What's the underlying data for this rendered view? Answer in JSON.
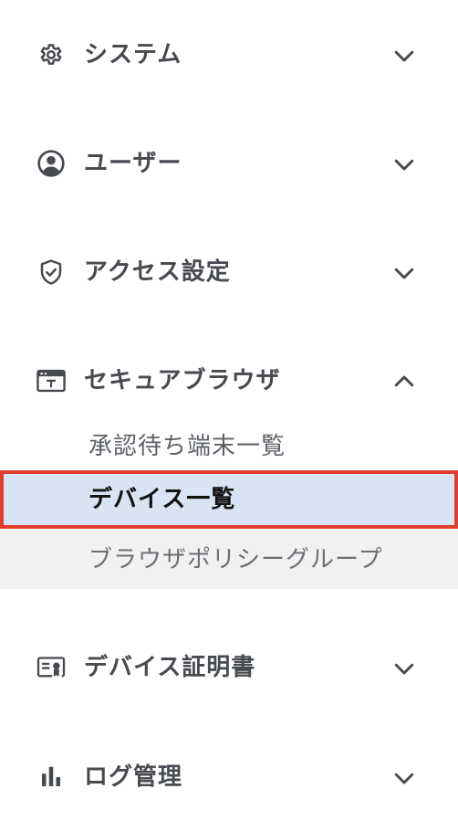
{
  "sections": [
    {
      "label": "システム",
      "icon": "gear-icon",
      "expanded": false
    },
    {
      "label": "ユーザー",
      "icon": "user-icon",
      "expanded": false
    },
    {
      "label": "アクセス設定",
      "icon": "shield-check-icon",
      "expanded": false
    },
    {
      "label": "セキュアブラウザ",
      "icon": "browser-window-icon",
      "expanded": true
    },
    {
      "label": "デバイス証明書",
      "icon": "certificate-icon",
      "expanded": false
    },
    {
      "label": "ログ管理",
      "icon": "bar-chart-icon",
      "expanded": false
    }
  ],
  "secure_browser_items": [
    {
      "label": "承認待ち端末一覧",
      "state": "normal"
    },
    {
      "label": "デバイス一覧",
      "state": "active"
    },
    {
      "label": "ブラウザポリシーグループ",
      "state": "hover"
    }
  ],
  "colors": {
    "text": "#474a4f",
    "active_bg": "#d8e3f4",
    "active_border": "#e03e2d",
    "hover_bg": "#f1f1f1"
  }
}
